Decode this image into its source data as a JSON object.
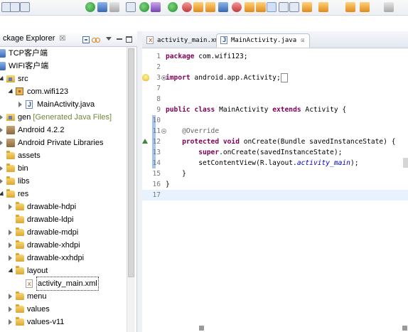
{
  "toolbar": {
    "icons": [
      "new-icon",
      "save-icon",
      "print-icon",
      "android-sdk-icon",
      "avd-manager-icon",
      "lint-icon",
      "new-android-project-icon",
      "debug-icon",
      "bug-icon",
      "run-icon",
      "coverage-icon",
      "external-tools-icon",
      "new-java-project-icon",
      "new-package-icon",
      "new-class-icon",
      "open-type-icon",
      "search-icon",
      "toggle-mark-occurrences-icon",
      "toggle-breadcrumb-icon",
      "pin-icon",
      "next-annotation-icon",
      "prev-annotation-icon",
      "last-edit-icon",
      "back-icon",
      "forward-icon"
    ]
  },
  "package_explorer": {
    "tab_label": "ckage Explorer",
    "tab_close": "☒",
    "tree": [
      {
        "label": "TCP客户端",
        "decoration": "",
        "icon": "project-icon",
        "depth": 0,
        "arrow": "closed"
      },
      {
        "label": "WIFI客户端",
        "decoration": "",
        "icon": "project-icon",
        "depth": 0,
        "arrow": "open"
      },
      {
        "label": "src",
        "decoration": "",
        "icon": "source-folder-icon",
        "depth": 1,
        "arrow": "open"
      },
      {
        "label": "com.wifi123",
        "decoration": "",
        "icon": "package-icon",
        "depth": 2,
        "arrow": "open"
      },
      {
        "label": "MainActivity.java",
        "decoration": "",
        "icon": "java-file-icon",
        "depth": 3,
        "arrow": "closed"
      },
      {
        "label": "gen",
        "decoration": " [Generated Java Files]",
        "icon": "source-folder-icon",
        "depth": 1,
        "arrow": "closed"
      },
      {
        "label": "Android 4.2.2",
        "decoration": "",
        "icon": "library-icon",
        "depth": 1,
        "arrow": "closed"
      },
      {
        "label": "Android Private Libraries",
        "decoration": "",
        "icon": "library-icon",
        "depth": 1,
        "arrow": "closed"
      },
      {
        "label": "assets",
        "decoration": "",
        "icon": "folder-icon",
        "depth": 1,
        "arrow": "none"
      },
      {
        "label": "bin",
        "decoration": "",
        "icon": "folder-icon",
        "depth": 1,
        "arrow": "closed"
      },
      {
        "label": "libs",
        "decoration": "",
        "icon": "folder-icon",
        "depth": 1,
        "arrow": "closed"
      },
      {
        "label": "res",
        "decoration": "",
        "icon": "folder-icon",
        "depth": 1,
        "arrow": "open"
      },
      {
        "label": "drawable-hdpi",
        "decoration": "",
        "icon": "folder-icon",
        "depth": 2,
        "arrow": "closed"
      },
      {
        "label": "drawable-ldpi",
        "decoration": "",
        "icon": "folder-icon",
        "depth": 2,
        "arrow": "none"
      },
      {
        "label": "drawable-mdpi",
        "decoration": "",
        "icon": "folder-icon",
        "depth": 2,
        "arrow": "closed"
      },
      {
        "label": "drawable-xhdpi",
        "decoration": "",
        "icon": "folder-icon",
        "depth": 2,
        "arrow": "closed"
      },
      {
        "label": "drawable-xxhdpi",
        "decoration": "",
        "icon": "folder-icon",
        "depth": 2,
        "arrow": "closed"
      },
      {
        "label": "layout",
        "decoration": "",
        "icon": "folder-icon",
        "depth": 2,
        "arrow": "open"
      },
      {
        "label": "activity_main.xml",
        "decoration": "",
        "icon": "xml-file-icon",
        "depth": 3,
        "arrow": "none"
      },
      {
        "label": "menu",
        "decoration": "",
        "icon": "folder-icon",
        "depth": 2,
        "arrow": "closed"
      },
      {
        "label": "values",
        "decoration": "",
        "icon": "folder-icon",
        "depth": 2,
        "arrow": "closed"
      },
      {
        "label": "values-v11",
        "decoration": "",
        "icon": "folder-icon",
        "depth": 2,
        "arrow": "closed"
      }
    ]
  },
  "editor": {
    "tabs": [
      {
        "label": "activity_main.xml",
        "icon": "xml-file-icon",
        "active": false
      },
      {
        "label": "MainActivity.java",
        "icon": "java-file-icon",
        "active": true,
        "close": "☒"
      }
    ],
    "lines": [
      {
        "n": "1",
        "parts": [
          [
            "kw",
            "package"
          ],
          [
            "",
            " com.wifi123;"
          ]
        ]
      },
      {
        "n": "2",
        "parts": []
      },
      {
        "n": "3",
        "fold": "plus",
        "marker": "bulb",
        "parts": [
          [
            "kw",
            "import"
          ],
          [
            "",
            " android.app.Activity;"
          ],
          [
            "box",
            " "
          ]
        ]
      },
      {
        "n": "7",
        "parts": []
      },
      {
        "n": "8",
        "parts": []
      },
      {
        "n": "9",
        "parts": [
          [
            "kw",
            "public"
          ],
          [
            "",
            " "
          ],
          [
            "kw",
            "class"
          ],
          [
            "",
            " MainActivity "
          ],
          [
            "kw",
            "extends"
          ],
          [
            "",
            " Activity {"
          ]
        ]
      },
      {
        "n": "10",
        "parts": [],
        "change": true
      },
      {
        "n": "11",
        "fold": "minus",
        "change": true,
        "parts": [
          [
            "",
            "    "
          ],
          [
            "ann",
            "@Override"
          ]
        ]
      },
      {
        "n": "12",
        "marker": "ovr",
        "change": true,
        "parts": [
          [
            "",
            "    "
          ],
          [
            "kw",
            "protected"
          ],
          [
            "",
            " "
          ],
          [
            "kw",
            "void"
          ],
          [
            "",
            " onCreate(Bundle savedInstanceState) {"
          ]
        ]
      },
      {
        "n": "13",
        "change": true,
        "parts": [
          [
            "",
            "        "
          ],
          [
            "kw",
            "super"
          ],
          [
            "",
            ".onCreate(savedInstanceState);"
          ]
        ]
      },
      {
        "n": "14",
        "change": true,
        "parts": [
          [
            "",
            "        setContentView(R.layout."
          ],
          [
            "fld",
            "activity_main"
          ],
          [
            "",
            ");"
          ]
        ]
      },
      {
        "n": "15",
        "parts": [
          [
            "",
            "    }"
          ]
        ]
      },
      {
        "n": "16",
        "parts": [
          [
            "",
            "}"
          ]
        ]
      },
      {
        "n": "17",
        "current": true,
        "parts": []
      }
    ]
  },
  "colors": {
    "keyword": "#7f0055",
    "annotation": "#646464",
    "field": "#0000c0",
    "current_line": "#e8f2fe",
    "change_bar": "#a9c5ec"
  }
}
